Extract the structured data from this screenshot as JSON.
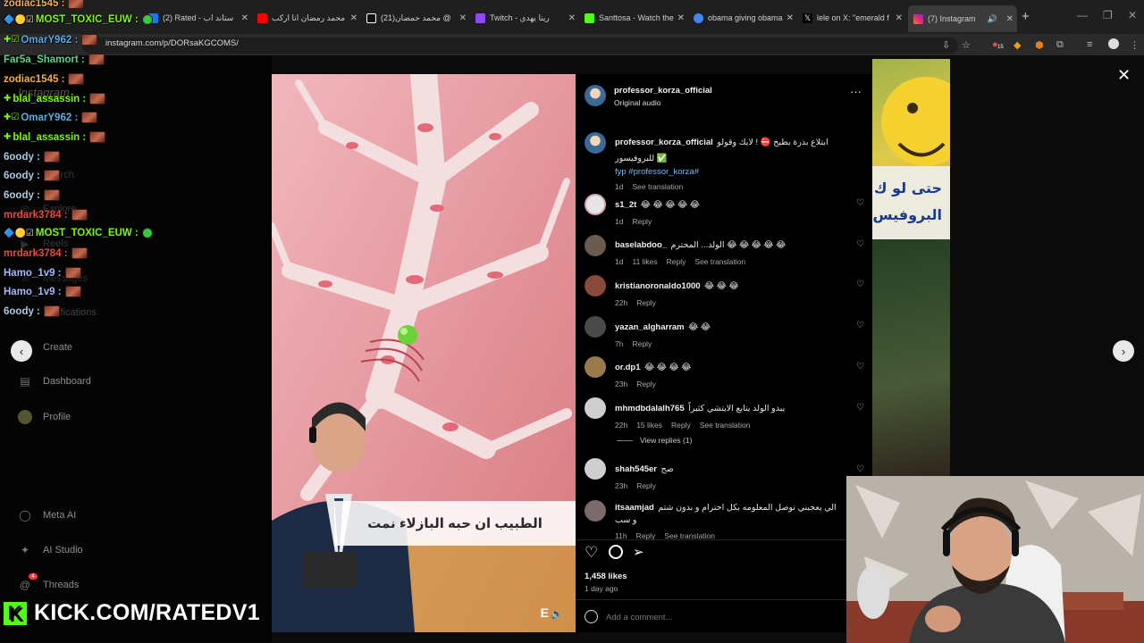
{
  "browser": {
    "tabs": [
      {
        "title": "(2) Rated - ستاند اب",
        "color": "#1877f2"
      },
      {
        "title": "محمد رمضان انا اركب",
        "color": "#ff0000"
      },
      {
        "title": "(21)محمد حمضان @",
        "color": "#ffffff"
      },
      {
        "title": "Twitch - رينا يهدي",
        "color": "#9146ff"
      },
      {
        "title": "Santtosa - Watch the",
        "color": "#53fc18"
      },
      {
        "title": "obama giving obama",
        "color": "#4285f4"
      },
      {
        "title": "lele on X: \"emerald f",
        "color": "#ffffff"
      },
      {
        "title": "(7) Instagram",
        "color": "#e1306c"
      }
    ],
    "url": "instagram.com/p/DORsaKGCOMS/",
    "extension_badge": "15"
  },
  "instagram_sidebar": {
    "wordmark": "Instagram",
    "items": [
      {
        "label": "Search",
        "icon": "search-icon"
      },
      {
        "label": "Explore",
        "icon": "compass-icon"
      },
      {
        "label": "Reels",
        "icon": "reels-icon"
      },
      {
        "label": "Messages",
        "icon": "messages-icon"
      },
      {
        "label": "Notifications",
        "icon": "heart-icon"
      },
      {
        "label": "Create",
        "icon": "plus-icon"
      },
      {
        "label": "Dashboard",
        "icon": "dashboard-icon"
      },
      {
        "label": "Profile",
        "icon": "profile-icon"
      },
      {
        "label": "Meta AI",
        "icon": "meta-ai-icon"
      },
      {
        "label": "AI Studio",
        "icon": "ai-studio-icon"
      },
      {
        "label": "Threads",
        "icon": "threads-icon",
        "badge": "4"
      }
    ]
  },
  "stream_chat": [
    {
      "user": "zodiac1545 :",
      "color": "#f5b041"
    },
    {
      "user": "MOST_TOXIC_EUW :",
      "color": "#7cfc00"
    },
    {
      "user": "OmarY962 :",
      "color": "#5dade2"
    },
    {
      "user": "Far5a_Shamort :",
      "color": "#58d68d"
    },
    {
      "user": "zodiac1545 :",
      "color": "#f5b041"
    },
    {
      "user": "blal_assassin :",
      "color": "#7cfc00"
    },
    {
      "user": "OmarY962 :",
      "color": "#5dade2"
    },
    {
      "user": "blal_assassin :",
      "color": "#7cfc00"
    },
    {
      "user": "6oody :",
      "color": "#a9cce3"
    },
    {
      "user": "6oody :",
      "color": "#a9cce3"
    },
    {
      "user": "6oody :",
      "color": "#a9cce3"
    },
    {
      "user": "mrdark3784 :",
      "color": "#e74c3c"
    },
    {
      "user": "MOST_TOXIC_EUW :",
      "color": "#7cfc00"
    },
    {
      "user": "mrdark3784 :",
      "color": "#e74c3c"
    },
    {
      "user": "Hamo_1v9 :",
      "color": "#aab7f8"
    },
    {
      "user": "Hamo_1v9 :",
      "color": "#aab7f8"
    },
    {
      "user": "6oody :",
      "color": "#a9cce3"
    }
  ],
  "kick_banner": "KICK.COM/RATEDV1",
  "video": {
    "caption": "الطبيب ان حبه البازلاء نمت"
  },
  "post": {
    "author": "professor_korza_official",
    "audio": "Original audio",
    "caption_user": "professor_korza_official",
    "caption_text": "ابتلاع بذرة بطيخ ⛔ ! لايك وقولو للبروفيسور ✅",
    "caption_tags": "fyp #professor_korza#",
    "caption_time": "1d",
    "caption_translate": "See translation",
    "comments": [
      {
        "user": "s1_2t",
        "text": "😂 😂 😂 😂 😂",
        "time": "1d",
        "likes": "",
        "reply": "Reply",
        "translate": "",
        "avatar": "#d9d9d9"
      },
      {
        "user": "baselabdoo_",
        "text": "الولد... المحترم 😂 😂 😂 😂 😂",
        "time": "1d",
        "likes": "11 likes",
        "reply": "Reply",
        "translate": "See translation",
        "avatar": "#6b5a4e"
      },
      {
        "user": "kristianoronaldo1000",
        "text": "😂 😂 😂",
        "time": "22h",
        "likes": "",
        "reply": "Reply",
        "translate": "",
        "avatar": "#8a4a3a"
      },
      {
        "user": "yazan_algharram",
        "text": "😂 😂",
        "time": "7h",
        "likes": "",
        "reply": "Reply",
        "translate": "",
        "avatar": "#4a4a4a"
      },
      {
        "user": "or.dp1",
        "text": "😂 😂 😂 😂",
        "time": "23h",
        "likes": "",
        "reply": "Reply",
        "translate": "",
        "avatar": "#9a7a4a"
      },
      {
        "user": "mhmdbdalalh765",
        "text": "يبدو الولد يتابع الايتشي كثيراً",
        "time": "22h",
        "likes": "15 likes",
        "reply": "Reply",
        "translate": "See translation",
        "avatar": "#cfcfcf"
      },
      {
        "user": "shah545er",
        "text": "صح",
        "time": "23h",
        "likes": "",
        "reply": "Reply",
        "translate": "",
        "avatar": "#cfcfcf"
      },
      {
        "user": "itsaamjad",
        "text": "الي يعجبني توصل المعلومه بكل احترام و بدون شتم و سب",
        "time": "11h",
        "likes": "",
        "reply": "Reply",
        "translate": "See translation",
        "avatar": "#7a6a6a"
      }
    ],
    "view_replies": "View replies (1)",
    "likes": "1,458 likes",
    "date": "1 day ago",
    "add_comment_placeholder": "Add a comment..."
  }
}
